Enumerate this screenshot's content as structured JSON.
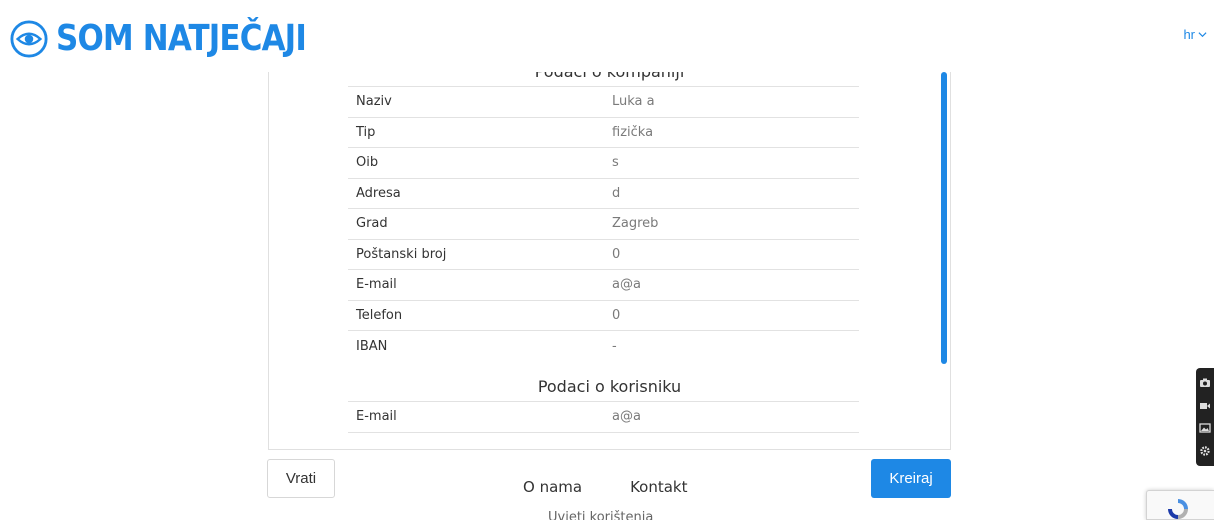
{
  "header": {
    "logo_text": "SOM NATJEČAJI",
    "language": "hr",
    "brand_color": "#1e88e5"
  },
  "company_section": {
    "title": "Podaci o kompaniji",
    "rows": [
      {
        "label": "Naziv",
        "value": "Luka a"
      },
      {
        "label": "Tip",
        "value": "fizička"
      },
      {
        "label": "Oib",
        "value": "s"
      },
      {
        "label": "Adresa",
        "value": "d"
      },
      {
        "label": "Grad",
        "value": "Zagreb"
      },
      {
        "label": "Poštanski broj",
        "value": "0"
      },
      {
        "label": "E-mail",
        "value": "a@a"
      },
      {
        "label": "Telefon",
        "value": "0"
      },
      {
        "label": "IBAN",
        "value": "-"
      }
    ]
  },
  "user_section": {
    "title": "Podaci o korisniku",
    "rows": [
      {
        "label": "E-mail",
        "value": "a@a"
      }
    ]
  },
  "actions": {
    "back_label": "Vrati",
    "create_label": "Kreiraj"
  },
  "footer": {
    "links": [
      "O nama",
      "Kontakt"
    ],
    "second_row": "Uvjeti korištenja"
  },
  "tool_icons": [
    "camera-icon",
    "video-icon",
    "image-icon",
    "settings-icon"
  ]
}
